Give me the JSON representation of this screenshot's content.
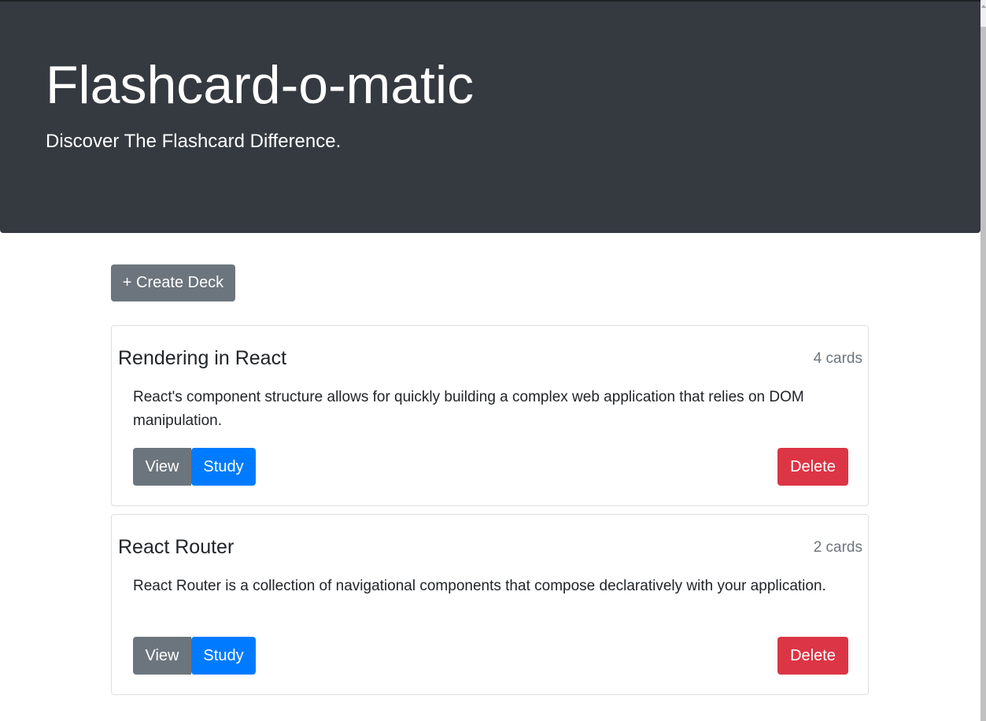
{
  "header": {
    "title": "Flashcard-o-matic",
    "subtitle": "Discover The Flashcard Difference."
  },
  "actions": {
    "create_deck_label": "+ Create Deck"
  },
  "decks": [
    {
      "name": "Rendering in React",
      "card_count": "4 cards",
      "description": "React's component structure allows for quickly building a complex web application that relies on DOM manipulation.",
      "view_label": "View",
      "study_label": "Study",
      "delete_label": "Delete"
    },
    {
      "name": "React Router",
      "card_count": "2 cards",
      "description": "React Router is a collection of navigational components that compose declaratively with your application.",
      "view_label": "View",
      "study_label": "Study",
      "delete_label": "Delete"
    }
  ],
  "colors": {
    "header_bg": "#343a40",
    "secondary": "#6c757d",
    "primary": "#007bff",
    "danger": "#dc3545"
  }
}
